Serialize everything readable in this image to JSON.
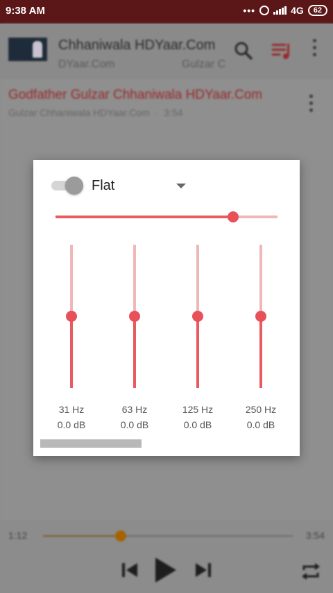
{
  "status_bar": {
    "time": "9:38 AM",
    "dots": "•••",
    "network": "4G",
    "battery": "62"
  },
  "header": {
    "title": "Chhaniwala HDYaar.Com",
    "subtitle_left": "DYaar.Com",
    "subtitle_right": "Gulzar C",
    "icons": [
      "album-art",
      "search-icon",
      "queue-icon",
      "more-vert-icon"
    ]
  },
  "song": {
    "title": "Godfather Gulzar Chhaniwala HDYaar.Com",
    "artist": "Gulzar Chhaniwala HDYaar.Com",
    "separator": "·",
    "duration": "3:54"
  },
  "player": {
    "elapsed": "1:12",
    "total": "3:54",
    "progress_fraction": 0.31,
    "icons": [
      "skip-previous-icon",
      "play-icon",
      "skip-next-icon",
      "repeat-icon"
    ]
  },
  "equalizer": {
    "enabled": false,
    "preset": "Flat",
    "master_level_fraction": 0.8,
    "bands": [
      {
        "freq": "31 Hz",
        "gain": "0.0 dB",
        "level_fraction": 0.5
      },
      {
        "freq": "63 Hz",
        "gain": "0.0 dB",
        "level_fraction": 0.5
      },
      {
        "freq": "125 Hz",
        "gain": "0.0 dB",
        "level_fraction": 0.5
      },
      {
        "freq": "250 Hz",
        "gain": "0.0 dB",
        "level_fraction": 0.5
      }
    ]
  },
  "colors": {
    "status_bar": "#5b1618",
    "accent": "#e85a5f",
    "accent_light": "#f0b7b8",
    "song_title": "#9a2a2a",
    "player_knob": "#a56300"
  }
}
